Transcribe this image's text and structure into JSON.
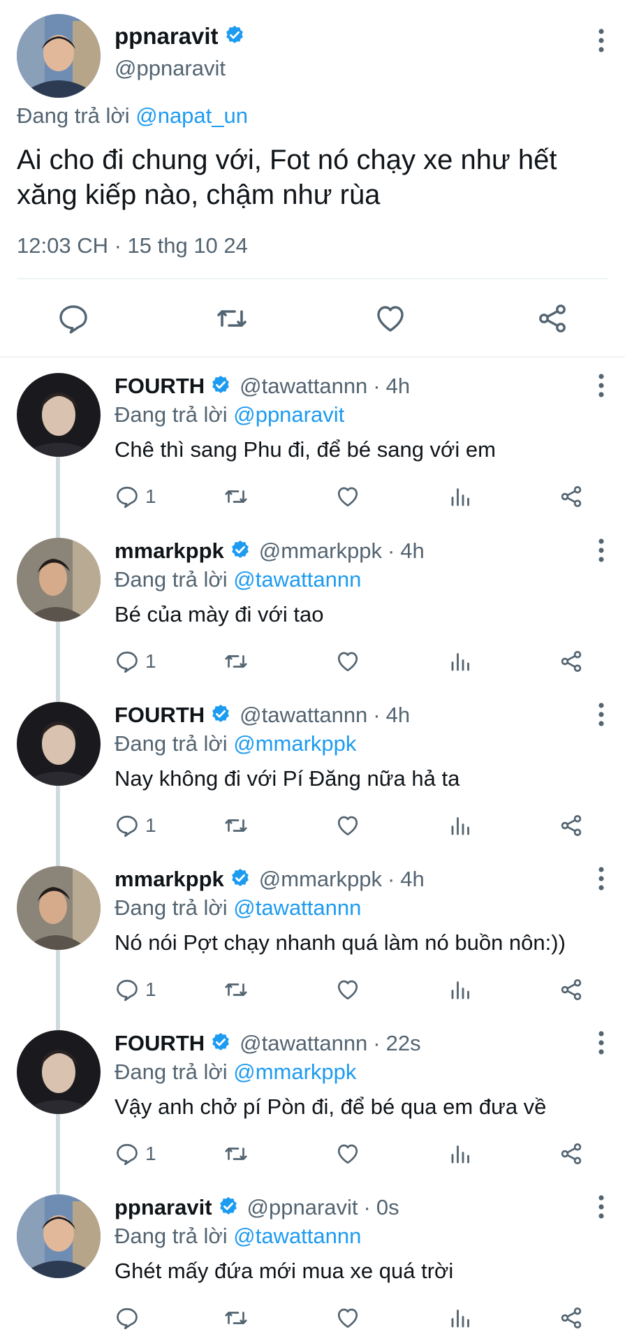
{
  "main_tweet": {
    "author_name": "ppnaravit",
    "author_handle": "@ppnaravit",
    "replying_prefix": "Đang trả lời ",
    "replying_to": "@napat_un",
    "text": "Ai cho đi chung với, Fot nó chạy xe như hết xăng kiếp nào, chậm như rùa",
    "timestamp": "12:03 CH · 15 thg 10 24",
    "actions": [
      "reply-icon",
      "retweet-icon",
      "like-icon",
      "share-icon"
    ]
  },
  "replies": [
    {
      "name": "FOURTH",
      "handle": "@tawattannn",
      "separator": "·",
      "time": "4h",
      "replying_prefix": "Đang trả lời ",
      "replying_to": "@ppnaravit",
      "text": "Chê thì sang Phu đi, để bé sang với em",
      "reply_count": "1"
    },
    {
      "name": "mmarkppk",
      "handle": "@mmarkppk",
      "separator": "·",
      "time": "4h",
      "replying_prefix": "Đang trả lời ",
      "replying_to": "@tawattannn",
      "text": "Bé của mày đi với tao",
      "reply_count": "1"
    },
    {
      "name": "FOURTH",
      "handle": "@tawattannn",
      "separator": "·",
      "time": "4h",
      "replying_prefix": "Đang trả lời ",
      "replying_to": "@mmarkppk",
      "text": "Nay không đi với Pí Đăng nữa hả ta",
      "reply_count": "1"
    },
    {
      "name": "mmarkppk",
      "handle": "@mmarkppk",
      "separator": "·",
      "time": "4h",
      "replying_prefix": "Đang trả lời ",
      "replying_to": "@tawattannn",
      "text": "Nó nói Pợt chạy nhanh quá làm nó buồn nôn:))",
      "reply_count": "1"
    },
    {
      "name": "FOURTH",
      "handle": "@tawattannn",
      "separator": "·",
      "time": "22s",
      "replying_prefix": "Đang trả lời ",
      "replying_to": "@mmarkppk",
      "text": "Vậy anh chở pí Pòn đi, để bé qua em đưa về",
      "reply_count": "1"
    },
    {
      "name": "ppnaravit",
      "handle": "@ppnaravit",
      "separator": "·",
      "time": "0s",
      "replying_prefix": "Đang trả lời ",
      "replying_to": "@tawattannn",
      "text": "Ghét mấy đứa mới mua xe quá trời",
      "reply_count": ""
    }
  ],
  "reply_action_icons": [
    "reply-icon",
    "retweet-icon",
    "like-icon",
    "views-icon",
    "share-icon"
  ],
  "colors": {
    "text": "#0f1419",
    "secondary": "#536471",
    "link": "#1d9bf0",
    "verified": "#1d9bf0",
    "divider": "#eff3f4",
    "thread_line": "#cfd9de"
  }
}
